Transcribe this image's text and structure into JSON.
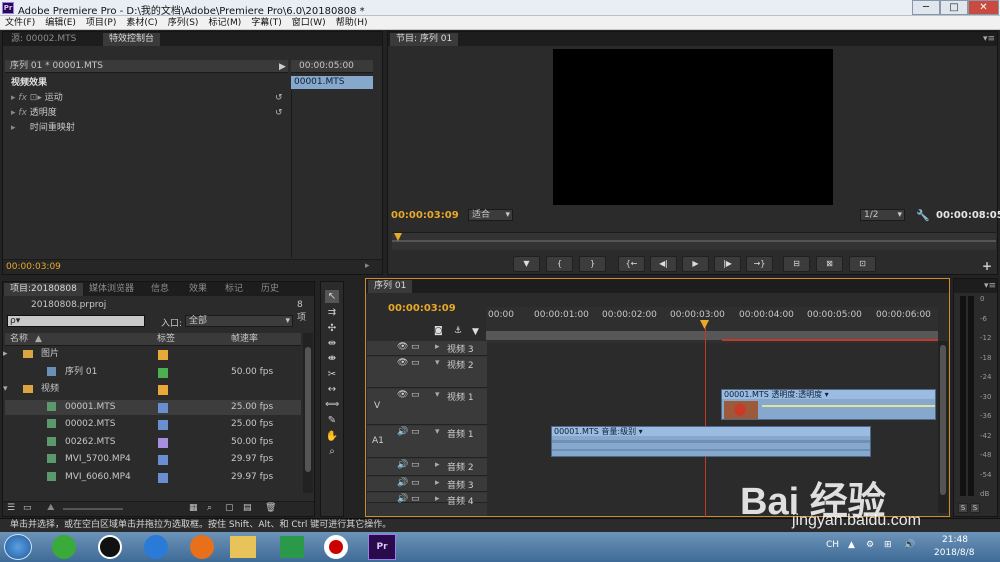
{
  "window": {
    "title": "Adobe Premiere Pro - D:\\我的文档\\Adobe\\Premiere Pro\\6.0\\20180808 *",
    "minimize": "─",
    "maximize": "□",
    "close": "✕"
  },
  "menu": [
    "文件(F)",
    "编辑(E)",
    "项目(P)",
    "素材(C)",
    "序列(S)",
    "标记(M)",
    "字幕(T)",
    "窗口(W)",
    "帮助(H)"
  ],
  "effects_panel": {
    "tabs": [
      "源: 00002.MTS",
      "特效控制台"
    ],
    "sequence_label": "序列 01 * 00001.MTS",
    "time_ruler": "00:00:05:00",
    "clip_bar": "00001.MTS",
    "section": "视频效果",
    "effects": [
      "运动",
      "透明度",
      "时间重映射"
    ],
    "timecode": "00:00:03:09"
  },
  "program": {
    "tab": "节目: 序列 01",
    "timecode": "00:00:03:09",
    "fit": "适合",
    "quality": "1/2",
    "duration": "00:00:08:05",
    "controls": [
      "▼",
      "{",
      "}",
      "{←",
      "◀|",
      "▶",
      "|▶",
      "→}",
      "⊟",
      "⊠",
      "⊡"
    ]
  },
  "project": {
    "tabs": [
      "项目:20180808",
      "媒体浏览器",
      "信息",
      "效果",
      "标记",
      "历史"
    ],
    "filename": "20180808.prproj",
    "item_count": "8 项",
    "search_placeholder": "ρ▾",
    "entry_label": "入口:",
    "entry_value": "全部",
    "columns": [
      "名称",
      "标签",
      "帧速率"
    ],
    "items": [
      {
        "name": "图片",
        "type": "folder",
        "label_color": "#e8a83a",
        "fps": ""
      },
      {
        "name": "序列 01",
        "type": "sequence",
        "label_color": "#4caf50",
        "fps": "50.00 fps"
      },
      {
        "name": "视频",
        "type": "folder",
        "label_color": "#e8a83a",
        "fps": ""
      },
      {
        "name": "00001.MTS",
        "type": "clip",
        "label_color": "#6a8fd0",
        "fps": "25.00 fps"
      },
      {
        "name": "00002.MTS",
        "type": "clip",
        "label_color": "#6a8fd0",
        "fps": "25.00 fps"
      },
      {
        "name": "00262.MTS",
        "type": "clip",
        "label_color": "#a88ee0",
        "fps": "50.00 fps"
      },
      {
        "name": "MVI_5700.MP4",
        "type": "clip",
        "label_color": "#6a8fd0",
        "fps": "29.97 fps"
      },
      {
        "name": "MVI_6060.MP4",
        "type": "clip",
        "label_color": "#6a8fd0",
        "fps": "29.97 fps"
      }
    ]
  },
  "timeline": {
    "tab": "序列 01",
    "timecode": "00:00:03:09",
    "ruler": [
      "00:00",
      "00:00:01:00",
      "00:00:02:00",
      "00:00:03:00",
      "00:00:04:00",
      "00:00:05:00",
      "00:00:06:00"
    ],
    "tracks": [
      "视频 3",
      "视频 2",
      "视频 1",
      "音频 1",
      "音频 2",
      "音频 3",
      "音频 4"
    ],
    "v_label": "V",
    "a_label": "A1",
    "video_clip": "00001.MTS  透明度:透明度 ▾",
    "audio_clip": "00001.MTS  音量:级别 ▾"
  },
  "meter": {
    "scale": [
      "0",
      "-6",
      "-12",
      "-18",
      "-24",
      "-30",
      "-36",
      "-42",
      "-48",
      "-54",
      "dB"
    ],
    "solo": [
      "S",
      "S"
    ]
  },
  "status": "单击并选择，或在空白区域单击并拖拉为选取框。按住 Shift、Alt、和 Ctrl 键可进行其它操作。",
  "taskbar": {
    "time": "21:48",
    "date": "2018/8/8",
    "lang": "CH"
  },
  "watermark": {
    "brand": "Bai 经验",
    "url": "jingyan.baidu.com"
  }
}
